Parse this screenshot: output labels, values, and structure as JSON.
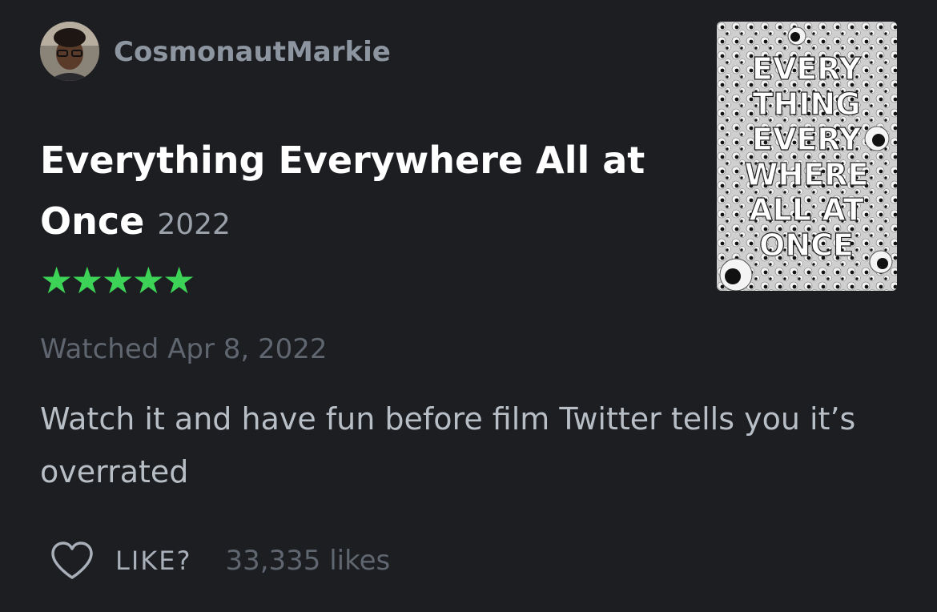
{
  "review": {
    "username": "CosmonautMarkie",
    "film_title": "Everything Everywhere All at Once",
    "film_year": "2022",
    "rating_stars": "★★★★★",
    "watched_label": "Watched Apr 8, 2022",
    "text": "Watch it and have fun before film Twitter tells you it’s overrated",
    "like_label": "LIKE?",
    "likes_count": "33,335 likes",
    "poster_title": [
      "EVERY",
      "THING",
      "EVERY",
      "WHERE",
      "ALL AT",
      "ONCE"
    ]
  },
  "colors": {
    "background": "#1c1e22",
    "star": "#3dd356",
    "username": "#8c95a0",
    "muted": "#5f6670",
    "body_text": "#b8bec6"
  }
}
